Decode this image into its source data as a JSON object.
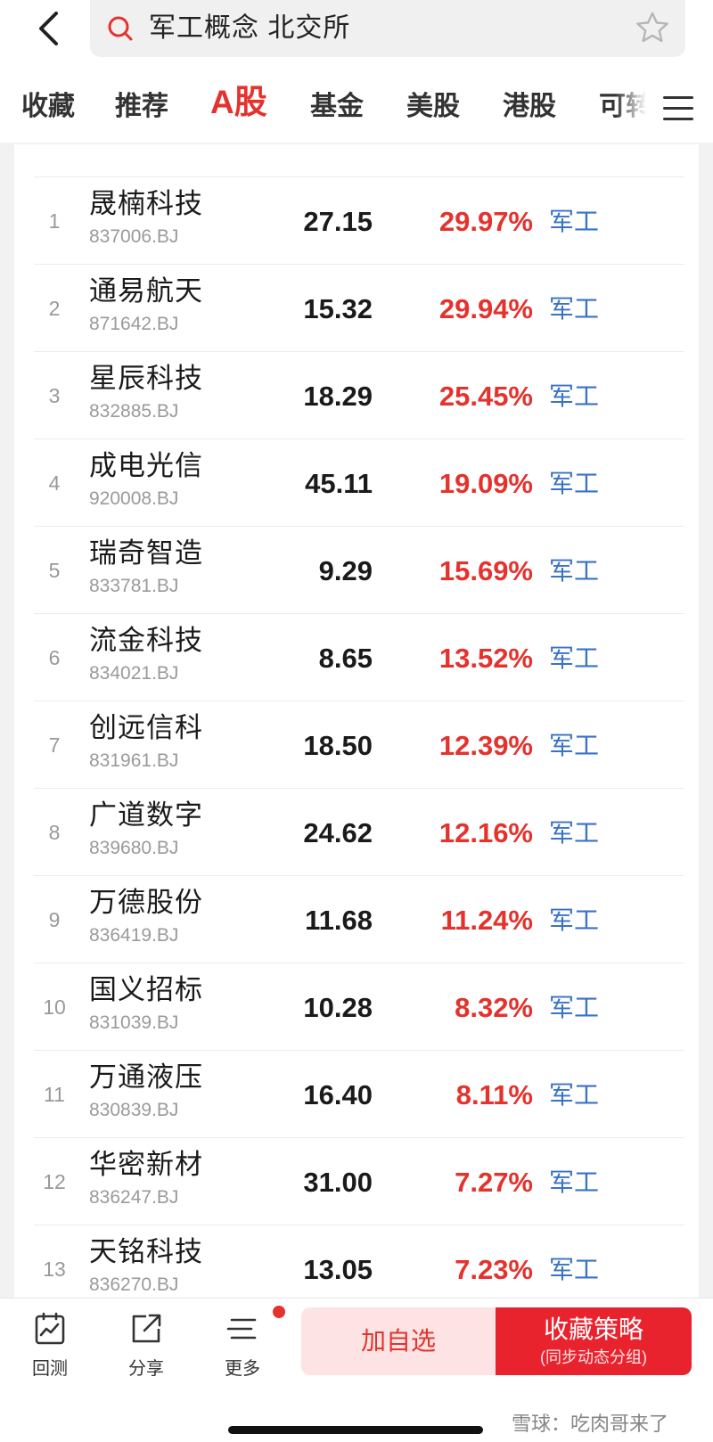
{
  "search": {
    "query": "军工概念 北交所"
  },
  "tabs": [
    {
      "label": "收藏"
    },
    {
      "label": "推荐"
    },
    {
      "label": "A股"
    },
    {
      "label": "基金"
    },
    {
      "label": "美股"
    },
    {
      "label": "港股"
    },
    {
      "label": "可转"
    }
  ],
  "list": {
    "rows": [
      {
        "rank": "1",
        "name": "晟楠科技",
        "code": "837006.BJ",
        "price": "27.15",
        "change": "29.97%",
        "concept": "军工"
      },
      {
        "rank": "2",
        "name": "通易航天",
        "code": "871642.BJ",
        "price": "15.32",
        "change": "29.94%",
        "concept": "军工"
      },
      {
        "rank": "3",
        "name": "星辰科技",
        "code": "832885.BJ",
        "price": "18.29",
        "change": "25.45%",
        "concept": "军工"
      },
      {
        "rank": "4",
        "name": "成电光信",
        "code": "920008.BJ",
        "price": "45.11",
        "change": "19.09%",
        "concept": "军工"
      },
      {
        "rank": "5",
        "name": "瑞奇智造",
        "code": "833781.BJ",
        "price": "9.29",
        "change": "15.69%",
        "concept": "军工"
      },
      {
        "rank": "6",
        "name": "流金科技",
        "code": "834021.BJ",
        "price": "8.65",
        "change": "13.52%",
        "concept": "军工"
      },
      {
        "rank": "7",
        "name": "创远信科",
        "code": "831961.BJ",
        "price": "18.50",
        "change": "12.39%",
        "concept": "军工"
      },
      {
        "rank": "8",
        "name": "广道数字",
        "code": "839680.BJ",
        "price": "24.62",
        "change": "12.16%",
        "concept": "军工"
      },
      {
        "rank": "9",
        "name": "万德股份",
        "code": "836419.BJ",
        "price": "11.68",
        "change": "11.24%",
        "concept": "军工"
      },
      {
        "rank": "10",
        "name": "国义招标",
        "code": "831039.BJ",
        "price": "10.28",
        "change": "8.32%",
        "concept": "军工"
      },
      {
        "rank": "11",
        "name": "万通液压",
        "code": "830839.BJ",
        "price": "16.40",
        "change": "8.11%",
        "concept": "军工"
      },
      {
        "rank": "12",
        "name": "华密新材",
        "code": "836247.BJ",
        "price": "31.00",
        "change": "7.27%",
        "concept": "军工"
      },
      {
        "rank": "13",
        "name": "天铭科技",
        "code": "836270.BJ",
        "price": "13.05",
        "change": "7.23%",
        "concept": "军工"
      }
    ]
  },
  "toolbar": {
    "backtest_label": "回测",
    "share_label": "分享",
    "more_label": "更多",
    "add_watchlist_label": "加自选",
    "save_strategy_label": "收藏策略",
    "save_strategy_sub": "(同步动态分组)"
  },
  "watermark": "雪球：吃肉哥来了",
  "colors": {
    "accent_red": "#e5322d",
    "concept_blue": "#3a72c6",
    "add_button_bg": "#fde3e3",
    "save_button_bg": "#e8232e"
  },
  "icons": [
    "back-icon",
    "search-icon",
    "star-icon",
    "menu-icon",
    "backtest-icon",
    "share-icon",
    "more-icon"
  ]
}
